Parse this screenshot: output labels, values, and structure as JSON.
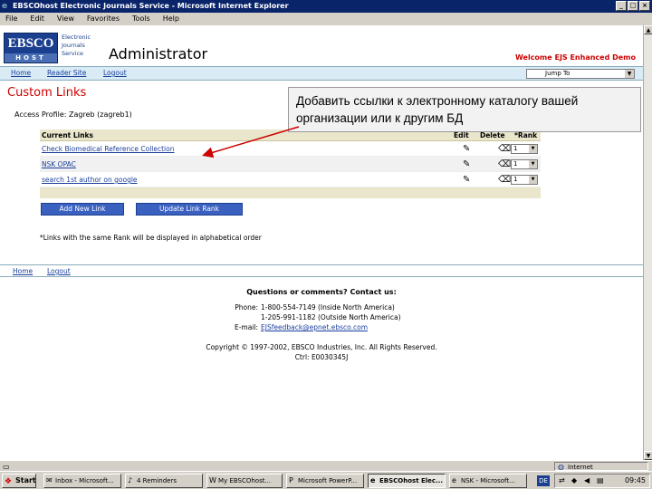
{
  "window": {
    "title": "EBSCOhost Electronic Journals Service - Microsoft Internet Explorer",
    "buttons": [
      "_",
      "□",
      "×"
    ]
  },
  "menu": [
    "File",
    "Edit",
    "View",
    "Favorites",
    "Tools",
    "Help"
  ],
  "header": {
    "logo_text": "EBSCO",
    "logo_subtext": "HOST",
    "service_name": "Electronic Journals Service",
    "page_heading": "Administrator",
    "welcome": "Welcome EJS Enhanced Demo",
    "jump_to": "Jump To"
  },
  "nav": {
    "home": "Home",
    "reader_site": "Reader Site",
    "logout": "Logout"
  },
  "section": {
    "title": "Custom Links",
    "access_profile": "Access Profile: Zagreb (zagreb1)"
  },
  "table": {
    "headers": {
      "current_links": "Current Links",
      "edit": "Edit",
      "delete": "Delete",
      "rank": "*Rank"
    },
    "rows": [
      {
        "name": "Check Biomedical Reference Collection",
        "rank": "1"
      },
      {
        "name": "NSK OPAC",
        "rank": "1"
      },
      {
        "name": "search 1st author on google",
        "rank": "1"
      }
    ]
  },
  "buttons": {
    "add_new_link": "Add New Link",
    "update_link_rank": "Update Link Rank"
  },
  "note": "*Links with the same Rank will be displayed in alphabetical order",
  "footer_nav": {
    "home": "Home",
    "logout": "Logout"
  },
  "contact": {
    "heading": "Questions or comments? Contact us:",
    "phone_label": "Phone:",
    "phone_1": "1-800-554-7149 (Inside North America)",
    "phone_2": "1-205-991-1182 (Outside North America)",
    "email_label": "E-mail:",
    "email": "EJSfeedback@epnet.ebsco.com",
    "copyright": "Copyright © 1997-2002, EBSCO Industries, Inc. All Rights Reserved.",
    "code": "Ctrl: E0030345J"
  },
  "callout": {
    "text": "Добавить ссылки к электронному каталогу вашей организации или к другим БД"
  },
  "status": {
    "zone": "Internet"
  },
  "taskbar": {
    "start": "Start",
    "tasks": [
      "Inbox - Microsoft...",
      "4 Reminders",
      "My EBSCOhost...",
      "Microsoft PowerP...",
      "EBSCOhost Elec...",
      "NSK - Microsoft..."
    ],
    "active_task": 4,
    "lang": "DE",
    "clock": "09:45"
  }
}
